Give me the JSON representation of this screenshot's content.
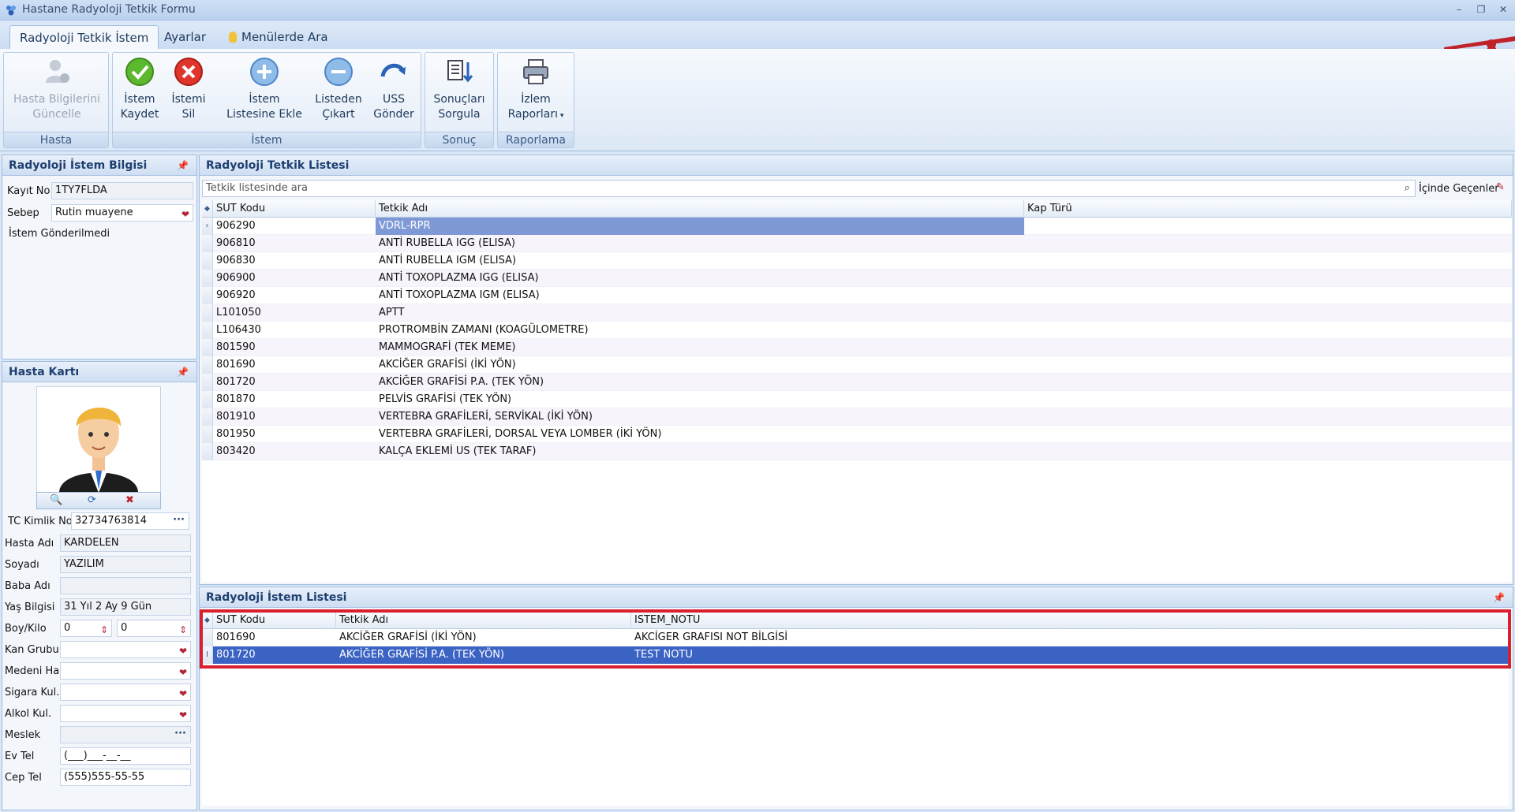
{
  "window": {
    "title": "Hastane Radyoloji Tetkik Formu"
  },
  "tabs": [
    {
      "label": "Radyoloji Tetkik İstem",
      "active": true
    },
    {
      "label": "Ayarlar"
    },
    {
      "label": "Menülerde Ara"
    }
  ],
  "ribbon": {
    "hasta": {
      "label": "Hasta",
      "update_line1": "Hasta Bilgilerini",
      "update_line2": "Güncelle"
    },
    "istem": {
      "label": "İstem",
      "save_line1": "İstem",
      "save_line2": "Kaydet",
      "delete_line1": "İstemi",
      "delete_line2": "Sil",
      "add_line1": "İstem",
      "add_line2": "Listesine Ekle",
      "remove_line1": "Listeden",
      "remove_line2": "Çıkart",
      "uss_line1": "USS",
      "uss_line2": "Gönder"
    },
    "sonuc": {
      "label": "Sonuç",
      "query_line1": "Sonuçları",
      "query_line2": "Sorgula"
    },
    "raporlama": {
      "label": "Raporlama",
      "reports_line1": "İzlem",
      "reports_line2": "Raporları"
    }
  },
  "istem_bilgisi": {
    "title": "Radyoloji İstem Bilgisi",
    "kayit_label": "Kayıt No",
    "kayit_value": "1TY7FLDA",
    "sebep_label": "Sebep",
    "sebep_value": "Rutin muayene",
    "status": "İstem Gönderilmedi"
  },
  "hasta_karti": {
    "title": "Hasta Kartı",
    "tc_label": "TC Kimlik No",
    "tc_value": "32734763814",
    "ad_label": "Hasta Adı",
    "ad_value": "KARDELEN",
    "soyad_label": "Soyadı",
    "soyad_value": "YAZILIM",
    "baba_label": "Baba Adı",
    "baba_value": "",
    "yas_label": "Yaş Bilgisi",
    "yas_value": "31 Yıl  2 Ay  9 Gün",
    "boy_label": "Boy/Kilo",
    "boy_value": "0",
    "kilo_value": "0",
    "kan_label": "Kan Grubu",
    "kan_value": "",
    "medeni_label": "Medeni Hal",
    "medeni_value": "",
    "sigara_label": "Sigara Kul.",
    "sigara_value": "",
    "alkol_label": "Alkol Kul.",
    "alkol_value": "",
    "meslek_label": "Meslek",
    "meslek_value": "",
    "evtel_label": "Ev Tel",
    "evtel_value": "(___)___-__-__",
    "ceptel_label": "Cep Tel",
    "ceptel_value": "(555)555-55-55"
  },
  "tetkik_listesi": {
    "title": "Radyoloji Tetkik Listesi",
    "search_placeholder": "Tetkik listesinde ara",
    "search_mode": "İçinde Geçenler",
    "columns": [
      "SUT Kodu",
      "Tetkik Adı",
      "Kap Türü"
    ],
    "rows": [
      [
        "906290",
        "VDRL-RPR",
        ""
      ],
      [
        "906810",
        "ANTİ RUBELLA IGG (ELISA)",
        ""
      ],
      [
        "906830",
        "ANTİ RUBELLA IGM (ELISA)",
        ""
      ],
      [
        "906900",
        "ANTİ TOXOPLAZMA IGG (ELISA)",
        ""
      ],
      [
        "906920",
        "ANTİ TOXOPLAZMA IGM (ELISA)",
        ""
      ],
      [
        "L101050",
        "APTT",
        ""
      ],
      [
        "L106430",
        "PROTROMBİN ZAMANI (KOAGÜLOMETRE)",
        ""
      ],
      [
        "801590",
        "MAMMOGRAFİ (TEK MEME)",
        ""
      ],
      [
        "801690",
        "AKCİĞER GRAFİSİ (İKİ YÖN)",
        ""
      ],
      [
        "801720",
        "AKCİĞER GRAFİSİ P.A. (TEK YÖN)",
        ""
      ],
      [
        "801870",
        "PELVİS GRAFİSİ (TEK YÖN)",
        ""
      ],
      [
        "801910",
        "VERTEBRA GRAFİLERİ, SERVİKAL (İKİ YÖN)",
        ""
      ],
      [
        "801950",
        "VERTEBRA GRAFİLERİ, DORSAL VEYA LOMBER (İKİ YÖN)",
        ""
      ],
      [
        "803420",
        "KALÇA EKLEMİ US (TEK TARAF)",
        ""
      ]
    ]
  },
  "istem_listesi": {
    "title": "Radyoloji İstem Listesi",
    "columns": [
      "SUT Kodu",
      "Tetkik Adı",
      "ISTEM_NOTU"
    ],
    "rows": [
      [
        "801690",
        "AKCİĞER GRAFİSİ (İKİ YÖN)",
        "AKCİGER GRAFISI NOT BİLGİSİ"
      ],
      [
        "801720",
        "AKCİĞER GRAFİSİ P.A. (TEK YÖN)",
        "TEST NOTU"
      ]
    ],
    "highlight_color": "#d9202e"
  }
}
